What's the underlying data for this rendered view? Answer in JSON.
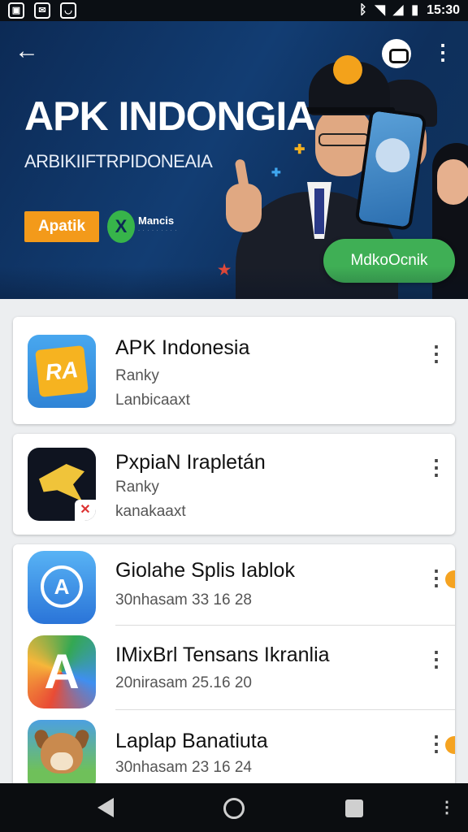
{
  "status_bar": {
    "time": "15:30",
    "left_icons": [
      "image-notification-icon",
      "mail-notification-icon",
      "shield-notification-icon"
    ],
    "right_icons": [
      "bluetooth-icon",
      "wifi-icon",
      "signal-icon",
      "battery-icon"
    ]
  },
  "hero": {
    "title": "APK INDONGIA",
    "subtitle": "ARBIKIIFTRPIDONEAIA",
    "brand_tag": "Apatik",
    "brand_logo_glyph": "X",
    "brand_name": "Mancis",
    "cta_label": "MdkoOcnik"
  },
  "apps": [
    {
      "title": "APK Indonesia",
      "line1": "Ranky",
      "line2": "Lanbicaaxt",
      "icon": "apk-indonesia-icon"
    },
    {
      "title": "PxpiaN Irapletán",
      "line1": "Ranky",
      "line2": "kanakaaxt",
      "icon": "bird-game-icon"
    },
    {
      "title": "Giolahe Splis Iablok",
      "line1": "30nhasam 33 16 28",
      "icon": "app-store-icon"
    },
    {
      "title": "IMixBrl Tensans Ikranlia",
      "line1": "20nirasam 25.16 20",
      "icon": "colorful-a-icon"
    },
    {
      "title": "Laplap Banatiuta",
      "line1": "30nhasam 23 16 24",
      "icon": "dog-game-icon"
    }
  ],
  "colors": {
    "accent_green": "#3faf55",
    "accent_orange": "#f39a1a",
    "hero_blue": "#123d73"
  }
}
